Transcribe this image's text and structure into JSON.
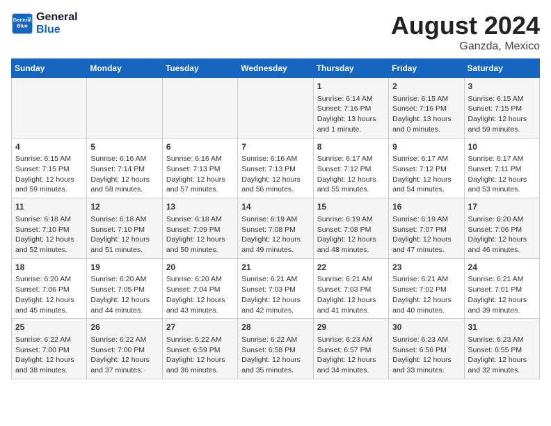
{
  "logo": {
    "line1": "General",
    "line2": "Blue"
  },
  "title": "August 2024",
  "location": "Ganzda, Mexico",
  "days_of_week": [
    "Sunday",
    "Monday",
    "Tuesday",
    "Wednesday",
    "Thursday",
    "Friday",
    "Saturday"
  ],
  "weeks": [
    [
      {
        "day": "",
        "content": ""
      },
      {
        "day": "",
        "content": ""
      },
      {
        "day": "",
        "content": ""
      },
      {
        "day": "",
        "content": ""
      },
      {
        "day": "1",
        "content": "Sunrise: 6:14 AM\nSunset: 7:16 PM\nDaylight: 13 hours\nand 1 minute."
      },
      {
        "day": "2",
        "content": "Sunrise: 6:15 AM\nSunset: 7:16 PM\nDaylight: 13 hours\nand 0 minutes."
      },
      {
        "day": "3",
        "content": "Sunrise: 6:15 AM\nSunset: 7:15 PM\nDaylight: 12 hours\nand 59 minutes."
      }
    ],
    [
      {
        "day": "4",
        "content": "Sunrise: 6:15 AM\nSunset: 7:15 PM\nDaylight: 12 hours\nand 59 minutes."
      },
      {
        "day": "5",
        "content": "Sunrise: 6:16 AM\nSunset: 7:14 PM\nDaylight: 12 hours\nand 58 minutes."
      },
      {
        "day": "6",
        "content": "Sunrise: 6:16 AM\nSunset: 7:13 PM\nDaylight: 12 hours\nand 57 minutes."
      },
      {
        "day": "7",
        "content": "Sunrise: 6:16 AM\nSunset: 7:13 PM\nDaylight: 12 hours\nand 56 minutes."
      },
      {
        "day": "8",
        "content": "Sunrise: 6:17 AM\nSunset: 7:12 PM\nDaylight: 12 hours\nand 55 minutes."
      },
      {
        "day": "9",
        "content": "Sunrise: 6:17 AM\nSunset: 7:12 PM\nDaylight: 12 hours\nand 54 minutes."
      },
      {
        "day": "10",
        "content": "Sunrise: 6:17 AM\nSunset: 7:11 PM\nDaylight: 12 hours\nand 53 minutes."
      }
    ],
    [
      {
        "day": "11",
        "content": "Sunrise: 6:18 AM\nSunset: 7:10 PM\nDaylight: 12 hours\nand 52 minutes."
      },
      {
        "day": "12",
        "content": "Sunrise: 6:18 AM\nSunset: 7:10 PM\nDaylight: 12 hours\nand 51 minutes."
      },
      {
        "day": "13",
        "content": "Sunrise: 6:18 AM\nSunset: 7:09 PM\nDaylight: 12 hours\nand 50 minutes."
      },
      {
        "day": "14",
        "content": "Sunrise: 6:19 AM\nSunset: 7:08 PM\nDaylight: 12 hours\nand 49 minutes."
      },
      {
        "day": "15",
        "content": "Sunrise: 6:19 AM\nSunset: 7:08 PM\nDaylight: 12 hours\nand 48 minutes."
      },
      {
        "day": "16",
        "content": "Sunrise: 6:19 AM\nSunset: 7:07 PM\nDaylight: 12 hours\nand 47 minutes."
      },
      {
        "day": "17",
        "content": "Sunrise: 6:20 AM\nSunset: 7:06 PM\nDaylight: 12 hours\nand 46 minutes."
      }
    ],
    [
      {
        "day": "18",
        "content": "Sunrise: 6:20 AM\nSunset: 7:06 PM\nDaylight: 12 hours\nand 45 minutes."
      },
      {
        "day": "19",
        "content": "Sunrise: 6:20 AM\nSunset: 7:05 PM\nDaylight: 12 hours\nand 44 minutes."
      },
      {
        "day": "20",
        "content": "Sunrise: 6:20 AM\nSunset: 7:04 PM\nDaylight: 12 hours\nand 43 minutes."
      },
      {
        "day": "21",
        "content": "Sunrise: 6:21 AM\nSunset: 7:03 PM\nDaylight: 12 hours\nand 42 minutes."
      },
      {
        "day": "22",
        "content": "Sunrise: 6:21 AM\nSunset: 7:03 PM\nDaylight: 12 hours\nand 41 minutes."
      },
      {
        "day": "23",
        "content": "Sunrise: 6:21 AM\nSunset: 7:02 PM\nDaylight: 12 hours\nand 40 minutes."
      },
      {
        "day": "24",
        "content": "Sunrise: 6:21 AM\nSunset: 7:01 PM\nDaylight: 12 hours\nand 39 minutes."
      }
    ],
    [
      {
        "day": "25",
        "content": "Sunrise: 6:22 AM\nSunset: 7:00 PM\nDaylight: 12 hours\nand 38 minutes."
      },
      {
        "day": "26",
        "content": "Sunrise: 6:22 AM\nSunset: 7:00 PM\nDaylight: 12 hours\nand 37 minutes."
      },
      {
        "day": "27",
        "content": "Sunrise: 6:22 AM\nSunset: 6:59 PM\nDaylight: 12 hours\nand 36 minutes."
      },
      {
        "day": "28",
        "content": "Sunrise: 6:22 AM\nSunset: 6:58 PM\nDaylight: 12 hours\nand 35 minutes."
      },
      {
        "day": "29",
        "content": "Sunrise: 6:23 AM\nSunset: 6:57 PM\nDaylight: 12 hours\nand 34 minutes."
      },
      {
        "day": "30",
        "content": "Sunrise: 6:23 AM\nSunset: 6:56 PM\nDaylight: 12 hours\nand 33 minutes."
      },
      {
        "day": "31",
        "content": "Sunrise: 6:23 AM\nSunset: 6:55 PM\nDaylight: 12 hours\nand 32 minutes."
      }
    ]
  ]
}
